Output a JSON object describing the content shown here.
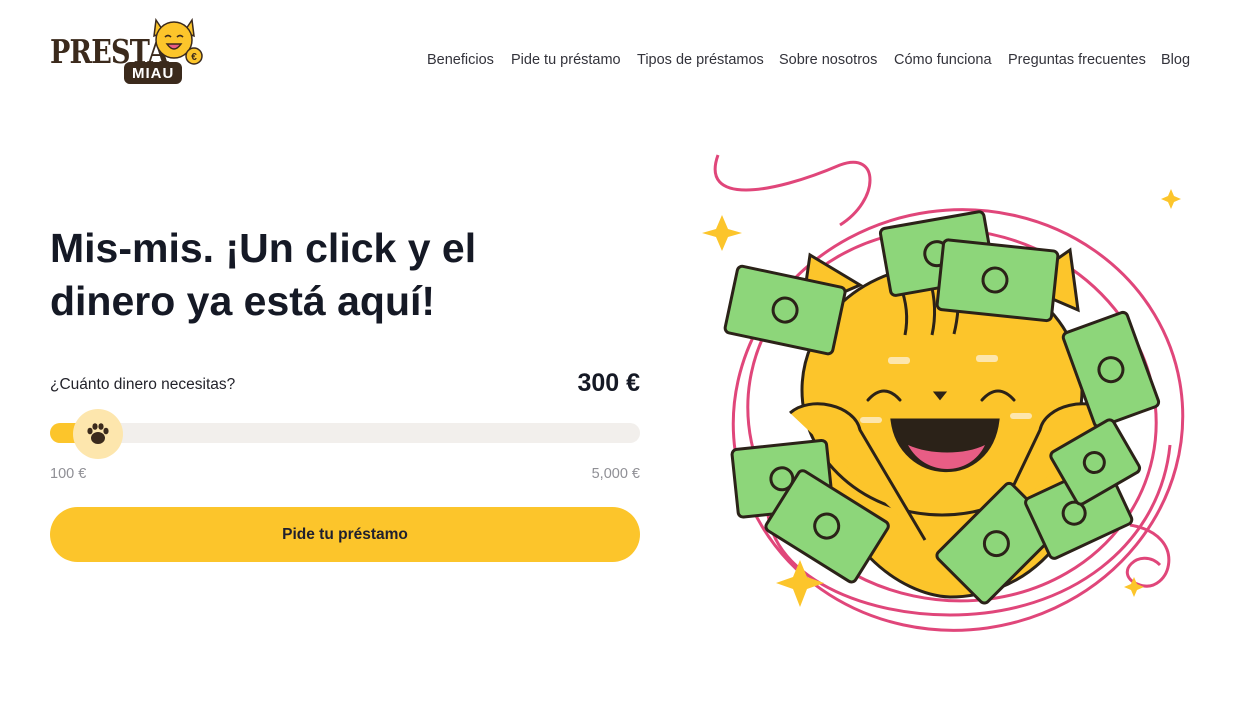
{
  "brand": {
    "logo_word_top": "PRESTA",
    "logo_word_bottom": "MIAU",
    "logo_coin_symbol": "€"
  },
  "nav": {
    "items": [
      {
        "label": "Beneficios"
      },
      {
        "label": "Pide tu préstamo"
      },
      {
        "label": "Tipos de préstamos"
      },
      {
        "label": "Sobre nosotros"
      },
      {
        "label": "Cómo funciona"
      },
      {
        "label": "Preguntas frecuentes"
      },
      {
        "label": "Blog"
      }
    ]
  },
  "hero": {
    "headline_line1": "Mis-mis. ¡Un click y el",
    "headline_line2": "dinero ya está aquí!",
    "question": "¿Cuánto dinero necesitas?",
    "amount": "300 €",
    "slider": {
      "min_label": "100 €",
      "max_label": "5,000 €",
      "min": 100,
      "max": 5000,
      "value": 300
    },
    "cta_label": "Pide tu préstamo"
  },
  "colors": {
    "accent": "#fcc52b",
    "thumb": "#fde6ad",
    "track": "#f2efec",
    "money": "#8dd67a",
    "swirl": "#e0467a",
    "brand_dark": "#3b2a1c"
  },
  "icons": {
    "slider_thumb": "paw-icon",
    "hero_art": "happy-cat-with-money-illustration"
  }
}
